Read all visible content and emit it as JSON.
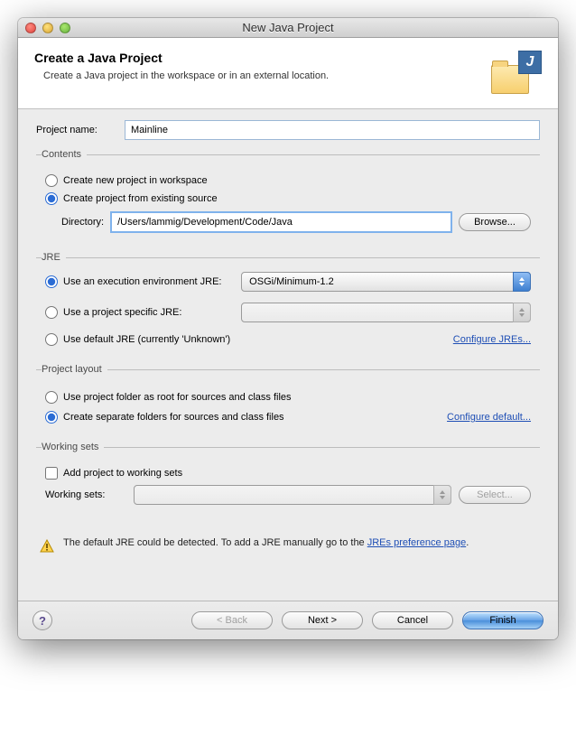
{
  "window": {
    "title": "New Java Project"
  },
  "header": {
    "heading": "Create a Java Project",
    "subheading": "Create a Java project in the workspace or in an external location."
  },
  "projectName": {
    "label": "Project name:",
    "value": "Mainline"
  },
  "contents": {
    "legend": "Contents",
    "opt_workspace": "Create new project in workspace",
    "opt_existing": "Create project from existing source",
    "directory_label": "Directory:",
    "directory_value": "/Users/lammig/Development/Code/Java",
    "browse_btn": "Browse..."
  },
  "jre": {
    "legend": "JRE",
    "opt_env": "Use an execution environment JRE:",
    "env_value": "OSGi/Minimum-1.2",
    "opt_specific": "Use a project specific JRE:",
    "specific_value": "",
    "opt_default": "Use default JRE (currently 'Unknown')",
    "configure_link": "Configure JREs..."
  },
  "layout": {
    "legend": "Project layout",
    "opt_root": "Use project folder as root for sources and class files",
    "opt_separate": "Create separate folders for sources and class files",
    "configure_link": "Configure default..."
  },
  "workingSets": {
    "legend": "Working sets",
    "check_label": "Add project to working sets",
    "ws_label": "Working sets:",
    "ws_value": "",
    "select_btn": "Select..."
  },
  "warning": {
    "text_before": "The default JRE could be detected. To add a JRE manually go to the ",
    "link": "JREs preference page",
    "text_after": "."
  },
  "footer": {
    "back": "< Back",
    "next": "Next >",
    "cancel": "Cancel",
    "finish": "Finish"
  }
}
